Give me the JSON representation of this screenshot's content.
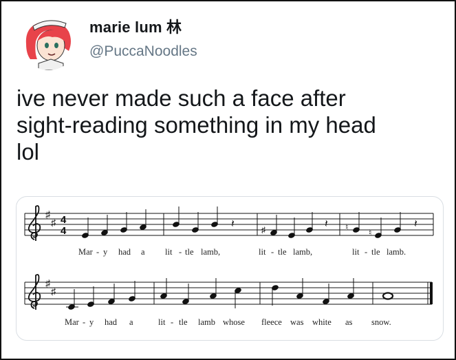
{
  "tweet": {
    "display_name": "marie lum 林",
    "handle": "@PuccaNoodles",
    "text_lines": [
      "ive never made such a face after",
      "sight-reading something in my head",
      "lol"
    ]
  },
  "sheet_music": {
    "lyrics_line1": [
      "Mar",
      "-",
      "y",
      "had",
      "a",
      "lit",
      "-",
      "tle",
      "lamb,",
      "lit",
      "-",
      "tle",
      "lamb,",
      "lit",
      "-",
      "tle",
      "lamb."
    ],
    "lyrics_line2": [
      "Mar",
      "-",
      "y",
      "had",
      "a",
      "lit",
      "-",
      "tle",
      "lamb",
      "whose",
      "fleece",
      "was",
      "white",
      "as",
      "snow."
    ]
  },
  "colors": {
    "text_primary": "#14171a",
    "text_secondary": "#657786",
    "card_border": "#d9dee3",
    "avatar_hair": "#e8434a"
  }
}
